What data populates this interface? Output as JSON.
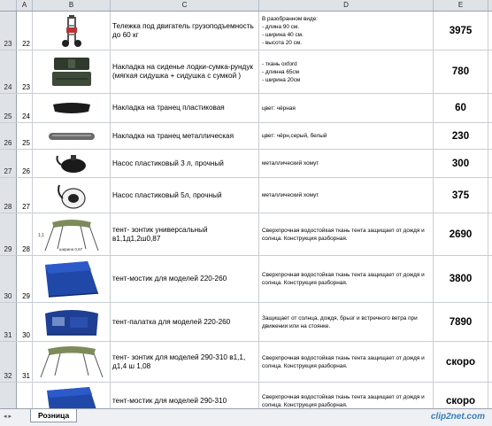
{
  "columns": {
    "A": "A",
    "B": "B",
    "C": "C",
    "D": "D",
    "E": "E"
  },
  "rows": [
    {
      "row": "23",
      "num": "22",
      "name": "Тележка под двигатель  грузоподъемность до 60 кг",
      "desc": "В разобранном   виде:\n- длина 90 см.\n- ширина 40 см.\n- высота 20 см.",
      "price": "3975",
      "image": "cart-image"
    },
    {
      "row": "24",
      "num": "23",
      "name": "Накладка на сиденье лодки-сумка-рундук (мягкая сидушка + сидушка с сумкой )",
      "desc": "- ткань oxford\n- длинна 65см\n- ширина 20см",
      "price": "780",
      "image": "seat-bag-image"
    },
    {
      "row": "25",
      "num": "24",
      "name": "Накладка на транец пластиковая",
      "desc": "цвет: чёрная",
      "price": "60",
      "image": "transom-plastic-image"
    },
    {
      "row": "26",
      "num": "25",
      "name": "Накладка на транец металлическая",
      "desc": "цвет: чёрн,серый, белый",
      "price": "230",
      "image": "transom-metal-image"
    },
    {
      "row": "27",
      "num": "26",
      "name": "Насос пластиковый 3 л, прочный",
      "desc": "металлический хомут",
      "price": "300",
      "image": "pump-3l-image"
    },
    {
      "row": "28",
      "num": "27",
      "name": "Насос пластиковый 5л, прочный",
      "desc": "металлический хомут",
      "price": "375",
      "image": "pump-5l-image"
    },
    {
      "row": "29",
      "num": "28",
      "name": "тент- зонтик     универсальный в1,1д1,2ш0,87",
      "desc": "Сверхпрочная водостойкая ткань тента  защищает от дождя и солнца. Конструкция разборная.",
      "price": "2690",
      "image": "umbrella-tent-image"
    },
    {
      "row": "30",
      "num": "29",
      "name": "тент-мостик   для моделей 220-260",
      "desc": "Сверхпрочная водостойкая ткань тента  защищает от дождя и солнца. Конструкция разборная.",
      "price": "3800",
      "image": "bridge-tent-image"
    },
    {
      "row": "31",
      "num": "30",
      "name": " тент-палатка   для моделей 220-260",
      "desc": "Защищает от солнца, дождя, брызг и встречного ветра при движении или на стоянке.",
      "price": "7890",
      "image": "tent-palatka-image"
    },
    {
      "row": "32",
      "num": "31",
      "name": "тент- зонтик   для моделей 290-310 в1,1, д1,4 ш 1,08",
      "desc": "Сверхпрочная водостойкая ткань тента  защищает от дождя и солнца. Конструкция разборная.",
      "price": "скоро",
      "image": "umbrella-tent-large-image"
    },
    {
      "row": "33",
      "num": "32",
      "name": " тент-мостик  для моделей 290-310",
      "desc": "Сверхпрочная водостойкая ткань тента  защищает от дождя и солнца. Конструкция разборная.",
      "price": "скоро",
      "image": "bridge-tent-large-image"
    }
  ],
  "image_labels": {
    "umbrella_dim": "1,1",
    "umbrella_width": "ширина 0,87"
  },
  "sheet_tab": "Розница",
  "nav_arrows": "◂ ▸",
  "watermark": "clip2net.com"
}
